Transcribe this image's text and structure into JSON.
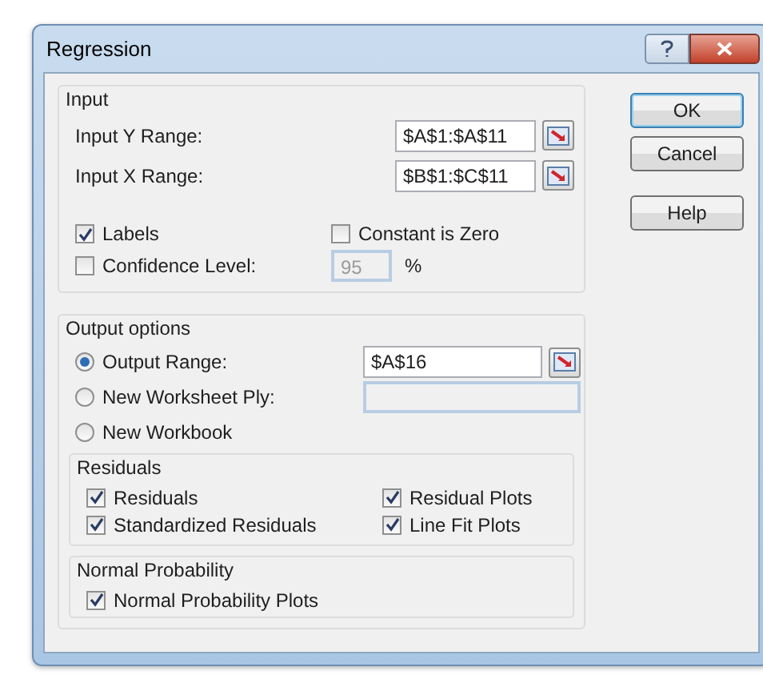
{
  "window": {
    "title": "Regression"
  },
  "input": {
    "title": "Input",
    "ranges": [
      {
        "label": "Input Y Range:",
        "value": "$A$1:$A$11"
      },
      {
        "label": "Input X Range:",
        "value": "$B$1:$C$11"
      }
    ],
    "labels": {
      "label": "Labels",
      "checked": true
    },
    "constant_is_zero": {
      "label": "Constant is Zero",
      "checked": false
    },
    "confidence": {
      "label": "Confidence Level:",
      "checked": false,
      "value": "95",
      "disabled": true,
      "unit": "%"
    }
  },
  "output": {
    "title": "Output options",
    "options": [
      {
        "label": "Output Range:",
        "selected": true,
        "value": "$A$16",
        "picker": true
      },
      {
        "label": "New Worksheet Ply:",
        "selected": false,
        "field": true
      },
      {
        "label": "New Workbook",
        "selected": false
      }
    ],
    "residuals": {
      "title": "Residuals",
      "checks": [
        {
          "label": "Residuals",
          "checked": true
        },
        {
          "label": "Residual Plots",
          "checked": true
        },
        {
          "label": "Standardized Residuals",
          "checked": true
        },
        {
          "label": "Line Fit Plots",
          "checked": true
        }
      ]
    },
    "normal_probability": {
      "title": "Normal Probability",
      "checks": [
        {
          "label": "Normal Probability Plots",
          "checked": true
        }
      ]
    }
  },
  "buttons": [
    {
      "label": "OK",
      "default": true
    },
    {
      "label": "Cancel",
      "default": false
    },
    {
      "label": "Help",
      "default": false
    }
  ]
}
